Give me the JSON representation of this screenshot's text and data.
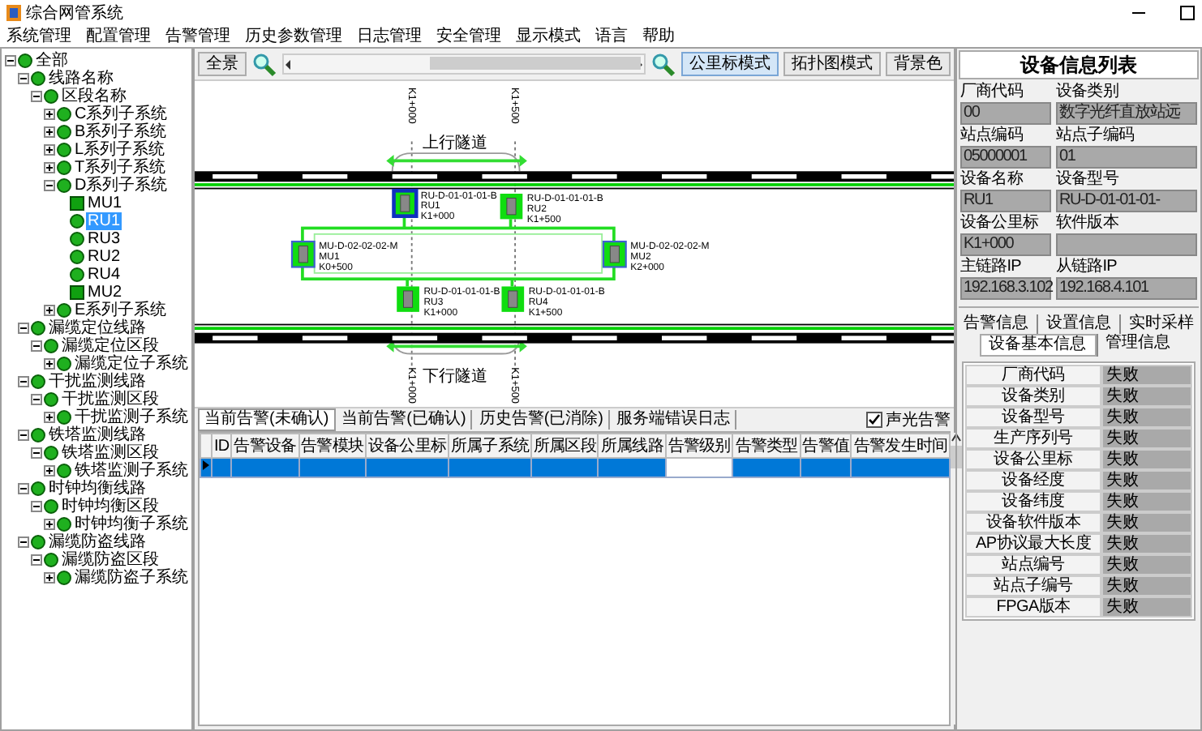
{
  "window": {
    "title": "综合网管系统"
  },
  "menu": [
    "系统管理",
    "配置管理",
    "告警管理",
    "历史参数管理",
    "日志管理",
    "安全管理",
    "显示模式",
    "语言",
    "帮助"
  ],
  "tree": [
    {
      "label": "全部",
      "kind": "group",
      "expanded": true,
      "selected": false,
      "children": [
        {
          "label": "线路名称",
          "kind": "group",
          "expanded": true,
          "selected": false,
          "children": [
            {
              "label": "区段名称",
              "kind": "group",
              "expanded": true,
              "selected": false,
              "children": [
                {
                  "label": "C系列子系统",
                  "kind": "group",
                  "expanded": false,
                  "selected": false
                },
                {
                  "label": "B系列子系统",
                  "kind": "group",
                  "expanded": false,
                  "selected": false
                },
                {
                  "label": "L系列子系统",
                  "kind": "group",
                  "expanded": false,
                  "selected": false
                },
                {
                  "label": "T系列子系统",
                  "kind": "group",
                  "expanded": false,
                  "selected": false
                },
                {
                  "label": "D系列子系统",
                  "kind": "group",
                  "expanded": true,
                  "selected": false,
                  "children": [
                    {
                      "label": "MU1",
                      "kind": "mu",
                      "selected": false
                    },
                    {
                      "label": "RU1",
                      "kind": "ru",
                      "selected": true
                    },
                    {
                      "label": "RU3",
                      "kind": "ru",
                      "selected": false
                    },
                    {
                      "label": "RU2",
                      "kind": "ru",
                      "selected": false
                    },
                    {
                      "label": "RU4",
                      "kind": "ru",
                      "selected": false
                    },
                    {
                      "label": "MU2",
                      "kind": "mu",
                      "selected": false
                    }
                  ]
                },
                {
                  "label": "E系列子系统",
                  "kind": "group",
                  "expanded": false,
                  "selected": false
                }
              ]
            }
          ]
        },
        {
          "label": "漏缆定位线路",
          "kind": "group",
          "expanded": true,
          "selected": false,
          "children": [
            {
              "label": "漏缆定位区段",
              "kind": "group",
              "expanded": true,
              "selected": false,
              "children": [
                {
                  "label": "漏缆定位子系统",
                  "kind": "group",
                  "expanded": false,
                  "selected": false
                }
              ]
            }
          ]
        },
        {
          "label": "干扰监测线路",
          "kind": "group",
          "expanded": true,
          "selected": false,
          "children": [
            {
              "label": "干扰监测区段",
              "kind": "group",
              "expanded": true,
              "selected": false,
              "children": [
                {
                  "label": "干扰监测子系统",
                  "kind": "group",
                  "expanded": false,
                  "selected": false
                }
              ]
            }
          ]
        },
        {
          "label": "铁塔监测线路",
          "kind": "group",
          "expanded": true,
          "selected": false,
          "children": [
            {
              "label": "铁塔监测区段",
              "kind": "group",
              "expanded": true,
              "selected": false,
              "children": [
                {
                  "label": "铁塔监测子系统",
                  "kind": "group",
                  "expanded": false,
                  "selected": false
                }
              ]
            }
          ]
        },
        {
          "label": "时钟均衡线路",
          "kind": "group",
          "expanded": true,
          "selected": false,
          "children": [
            {
              "label": "时钟均衡区段",
              "kind": "group",
              "expanded": true,
              "selected": false,
              "children": [
                {
                  "label": "时钟均衡子系统",
                  "kind": "group",
                  "expanded": false,
                  "selected": false
                }
              ]
            }
          ]
        },
        {
          "label": "漏缆防盗线路",
          "kind": "group",
          "expanded": true,
          "selected": false,
          "children": [
            {
              "label": "漏缆防盗区段",
              "kind": "group",
              "expanded": true,
              "selected": false,
              "children": [
                {
                  "label": "漏缆防盗子系统",
                  "kind": "group",
                  "expanded": false,
                  "selected": false
                }
              ]
            }
          ]
        }
      ]
    }
  ],
  "toolbar": {
    "overview_button": "全景",
    "mode_buttons": [
      {
        "label": "公里标模式",
        "selected": true
      },
      {
        "label": "拓扑图模式",
        "selected": false
      }
    ],
    "color_button": "背景色"
  },
  "canvas": {
    "top_markers": [
      "K1+000",
      "K1+500"
    ],
    "bottom_markers": [
      "K1+000",
      "K1+500"
    ],
    "upper_tunnel": "上行隧道",
    "lower_tunnel": "下行隧道",
    "devices": [
      {
        "kind": "ru",
        "code": "RU-D-01-01-01-B",
        "name": "RU1",
        "km": "K1+000",
        "selected": true
      },
      {
        "kind": "ru",
        "code": "RU-D-01-01-01-B",
        "name": "RU2",
        "km": "K1+500",
        "selected": false
      },
      {
        "kind": "mu",
        "code": "MU-D-02-02-02-M",
        "name": "MU1",
        "km": "K0+500",
        "selected": false
      },
      {
        "kind": "mu",
        "code": "MU-D-02-02-02-M",
        "name": "MU2",
        "km": "K2+000",
        "selected": false
      },
      {
        "kind": "ru",
        "code": "RU-D-01-01-01-B",
        "name": "RU3",
        "km": "K1+000",
        "selected": false
      },
      {
        "kind": "ru",
        "code": "RU-D-01-01-01-B",
        "name": "RU4",
        "km": "K1+500",
        "selected": false
      }
    ]
  },
  "alarm_tabs": [
    {
      "label": "当前告警(未确认)",
      "selected": true
    },
    {
      "label": "当前告警(已确认)",
      "selected": false
    },
    {
      "label": "历史告警(已消除)",
      "selected": false
    },
    {
      "label": "服务端错误日志",
      "selected": false
    }
  ],
  "sound_alarm": {
    "label": "声光告警",
    "checked": true
  },
  "alarm_table": {
    "columns": [
      "ID",
      "告警设备",
      "告警模块",
      "设备公里标",
      "所属子系统",
      "所属区段",
      "所属线路",
      "告警级别",
      "告警类型",
      "告警值",
      "告警发生时间"
    ],
    "rows": [
      {
        "selected": true,
        "cells": [
          {
            "focused": false
          },
          {
            "focused": false
          },
          {
            "focused": false
          },
          {
            "focused": false
          },
          {
            "focused": false
          },
          {
            "focused": false
          },
          {
            "focused": false
          },
          {
            "focused": true
          },
          {
            "focused": false
          },
          {
            "focused": false
          },
          {
            "focused": false
          }
        ]
      }
    ]
  },
  "info_panel": {
    "title": "设备信息列表",
    "fields": [
      {
        "label": "厂商代码",
        "value": "00"
      },
      {
        "label": "设备类别",
        "value": "数字光纤直放站远"
      },
      {
        "label": "站点编码",
        "value": "05000001"
      },
      {
        "label": "站点子编码",
        "value": "01"
      },
      {
        "label": "设备名称",
        "value": "RU1"
      },
      {
        "label": "设备型号",
        "value": "RU-D-01-01-01-"
      },
      {
        "label": "设备公里标",
        "value": "K1+000"
      },
      {
        "label": "软件版本"
      },
      {
        "label": "主链路IP",
        "value": "192.168.3.102"
      },
      {
        "label": "从链路IP",
        "value": "192.168.4.101"
      }
    ],
    "tab_rows": [
      {
        "tabs": [
          {
            "label": "告警信息",
            "selected": false
          },
          {
            "label": "设置信息",
            "selected": false
          },
          {
            "label": "实时采样",
            "selected": false
          }
        ]
      },
      {
        "tabs": [
          {
            "label": "设备基本信息",
            "selected": true
          },
          {
            "label": "管理信息",
            "selected": false
          }
        ]
      }
    ],
    "details": [
      {
        "name": "厂商代码",
        "value": "失败"
      },
      {
        "name": "设备类别",
        "value": "失败"
      },
      {
        "name": "设备型号",
        "value": "失败"
      },
      {
        "name": "生产序列号",
        "value": "失败"
      },
      {
        "name": "设备公里标",
        "value": "失败"
      },
      {
        "name": "设备经度",
        "value": "失败"
      },
      {
        "name": "设备纬度",
        "value": "失败"
      },
      {
        "name": "设备软件版本",
        "value": "失败"
      },
      {
        "name": "AP协议最大长度",
        "value": "失败"
      },
      {
        "name": "站点编号",
        "value": "失败"
      },
      {
        "name": "站点子编号",
        "value": "失败"
      },
      {
        "name": "FPGA版本",
        "value": "失败"
      }
    ]
  }
}
